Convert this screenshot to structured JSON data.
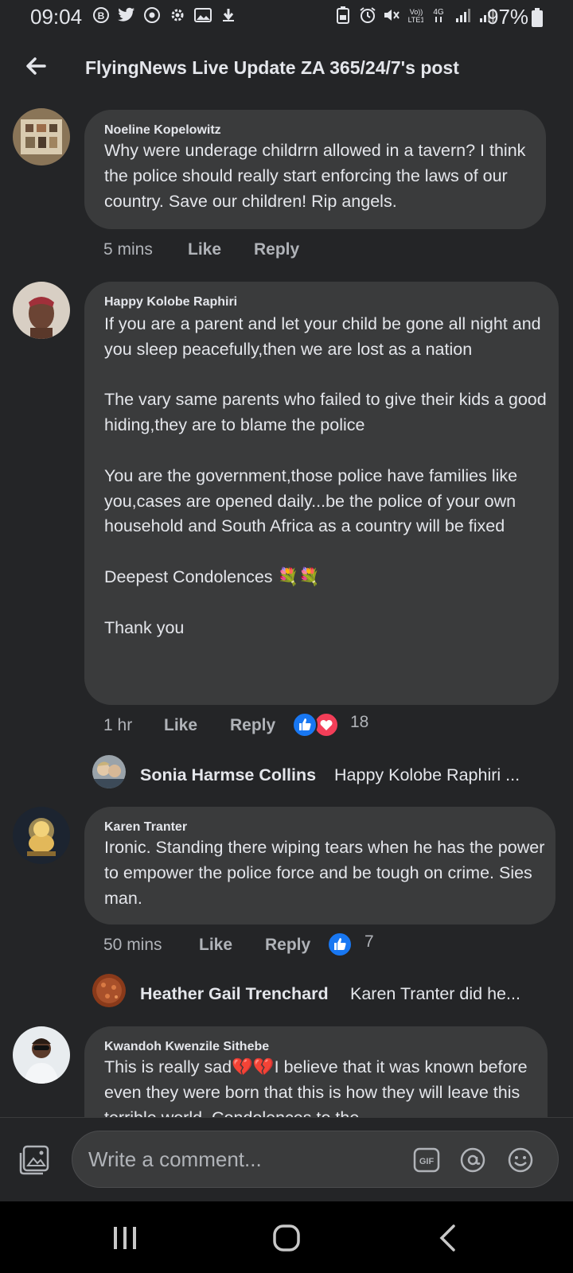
{
  "status_bar": {
    "time": "09:04",
    "battery": "97%"
  },
  "header": {
    "title": "FlyingNews Live Update ZA 365/24/7's post"
  },
  "comments": [
    {
      "author": "Noeline Kopelowitz",
      "text": "Why were underage childrrn allowed in a tavern? I think the police should really start enforcing the laws of our country. Save our children! Rip angels.",
      "time": "5 mins",
      "like_label": "Like",
      "reply_label": "Reply"
    },
    {
      "author": "Happy Kolobe Raphiri",
      "text": "If you are a parent and let your child be gone all night and you sleep peacefully,then we are lost as a nation\n\nThe vary same parents who failed to give their kids a good hiding,they are to blame the police\n\nYou are the government,those police have families like you,cases are opened daily...be the police of your own household and South Africa as a country will be fixed\n\nDeepest Condolences 💐💐\n\nThank you",
      "time": "1 hr",
      "like_label": "Like",
      "reply_label": "Reply",
      "reaction_count": "18",
      "reply_preview": {
        "name": "Sonia Harmse Collins",
        "snippet": "Happy Kolobe Raphiri ..."
      }
    },
    {
      "author": "Karen Tranter",
      "text": "Ironic. Standing there wiping tears when he has the power to empower the police force and be tough on crime. Sies man.",
      "time": "50 mins",
      "like_label": "Like",
      "reply_label": "Reply",
      "reaction_count": "7",
      "reply_preview": {
        "name": "Heather Gail Trenchard",
        "snippet": "Karen Tranter did he..."
      }
    },
    {
      "author": "Kwandoh Kwenzile Sithebe",
      "text": "This is really sad💔💔I believe that it was known before even they were born that this is how they will leave this terrible world. Condolences to the"
    }
  ],
  "composer": {
    "placeholder": "Write a comment..."
  },
  "colors": {
    "background": "#242527",
    "bubble": "#3a3b3c",
    "like_blue": "#1877f2",
    "love_red": "#f33e58"
  }
}
